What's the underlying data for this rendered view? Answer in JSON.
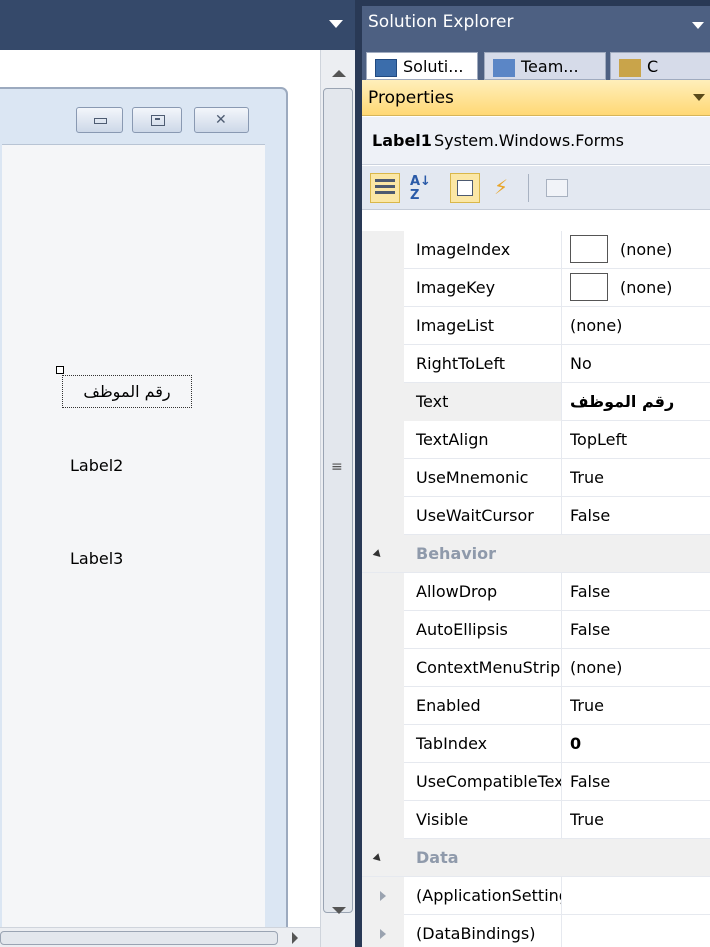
{
  "designer": {
    "label1": "رقم الموظف",
    "label2": "Label2",
    "label3": "Label3"
  },
  "solution_explorer": {
    "title": "Solution Explorer",
    "tabs": [
      "Soluti...",
      "Team...",
      "C"
    ]
  },
  "properties": {
    "title": "Properties",
    "object_name": "Label1",
    "object_type": "System.Windows.Forms",
    "toolbar_icons": [
      "categorized-icon",
      "alphabetical-icon",
      "properties-icon",
      "events-icon",
      "property-pages-icon"
    ],
    "rows": [
      {
        "name": "ImageIndex",
        "value": "(none)"
      },
      {
        "name": "ImageKey",
        "value": "(none)"
      },
      {
        "name": "ImageList",
        "value": "(none)"
      },
      {
        "name": "RightToLeft",
        "value": "No"
      },
      {
        "name": "Text",
        "value": "رقم الموظف"
      },
      {
        "name": "TextAlign",
        "value": "TopLeft"
      },
      {
        "name": "UseMnemonic",
        "value": "True"
      },
      {
        "name": "UseWaitCursor",
        "value": "False"
      }
    ],
    "behavior_category": "Behavior",
    "behavior_rows": [
      {
        "name": "AllowDrop",
        "value": "False"
      },
      {
        "name": "AutoEllipsis",
        "value": "False"
      },
      {
        "name": "ContextMenuStrip",
        "value": "(none)"
      },
      {
        "name": "Enabled",
        "value": "True"
      },
      {
        "name": "TabIndex",
        "value": "0"
      },
      {
        "name": "UseCompatibleTextRendering",
        "value": "False"
      },
      {
        "name": "Visible",
        "value": "True"
      }
    ],
    "data_category": "Data",
    "data_rows": [
      {
        "name": "(ApplicationSettings)",
        "value": ""
      },
      {
        "name": "(DataBindings)",
        "value": ""
      }
    ]
  }
}
